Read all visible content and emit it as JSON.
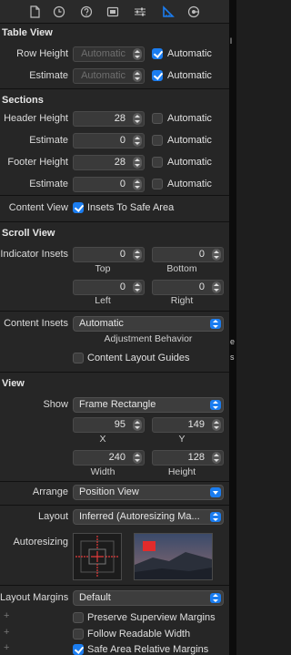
{
  "toolbar": {
    "icons": [
      "file-inspector-icon",
      "history-icon",
      "help-icon",
      "identity-icon",
      "attributes-icon",
      "size-inspector-icon",
      "connections-icon"
    ],
    "selected": "size-inspector-icon",
    "accent": "#1b7df0"
  },
  "table_view": {
    "title": "Table View",
    "row_height": {
      "label": "Row Height",
      "value": "Automatic",
      "check_label": "Automatic",
      "checked": true
    },
    "estimate": {
      "label": "Estimate",
      "value": "Automatic",
      "check_label": "Automatic",
      "checked": true
    }
  },
  "sections": {
    "title": "Sections",
    "header_height": {
      "label": "Header Height",
      "value": "28",
      "check_label": "Automatic",
      "checked": false
    },
    "header_estimate": {
      "label": "Estimate",
      "value": "0",
      "check_label": "Automatic",
      "checked": false
    },
    "footer_height": {
      "label": "Footer Height",
      "value": "28",
      "check_label": "Automatic",
      "checked": false
    },
    "footer_estimate": {
      "label": "Estimate",
      "value": "0",
      "check_label": "Automatic",
      "checked": false
    },
    "content_view": {
      "label": "Content View",
      "check_label": "Insets To Safe Area",
      "checked": true
    }
  },
  "scroll_view": {
    "title": "Scroll View",
    "indicator_insets": {
      "label": "Indicator Insets",
      "top": "0",
      "bottom": "0",
      "left": "0",
      "right": "0",
      "top_label": "Top",
      "bottom_label": "Bottom",
      "left_label": "Left",
      "right_label": "Right"
    },
    "content_insets": {
      "label": "Content Insets",
      "value": "Automatic",
      "sublabel": "Adjustment Behavior"
    },
    "layout_guides": {
      "check_label": "Content Layout Guides",
      "checked": false
    }
  },
  "view": {
    "title": "View",
    "show": {
      "label": "Show",
      "value": "Frame Rectangle"
    },
    "x": "95",
    "y": "149",
    "x_label": "X",
    "y_label": "Y",
    "width": "240",
    "height": "128",
    "width_label": "Width",
    "height_label": "Height",
    "arrange": {
      "label": "Arrange",
      "value": "Position View"
    },
    "layout": {
      "label": "Layout",
      "value": "Inferred (Autoresizing Ma..."
    },
    "autoresizing": {
      "label": "Autoresizing"
    },
    "layout_margins": {
      "label": "Layout Margins",
      "value": "Default"
    },
    "preserve_superview_margins": {
      "check_label": "Preserve Superview Margins",
      "checked": false
    },
    "follow_readable_width": {
      "check_label": "Follow Readable Width",
      "checked": false
    },
    "safe_area_relative_margins": {
      "check_label": "Safe Area Relative Margins",
      "checked": true
    }
  }
}
